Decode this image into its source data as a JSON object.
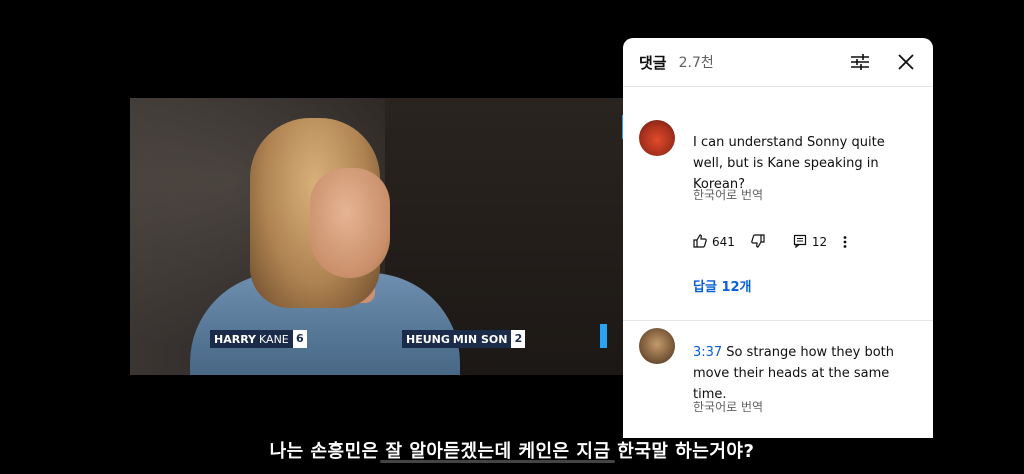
{
  "video": {
    "lower_thirds": [
      {
        "first": "HARRY",
        "last": "KANE",
        "number": "6"
      },
      {
        "first": "HEUNG",
        "last": "MIN SON",
        "number": "2"
      }
    ],
    "subtitle": "나는 손흥민은 잘 알아듣겠는데 케인은 지금 한국말 하는거야?"
  },
  "comments_panel": {
    "title": "댓글",
    "count": "2.7천",
    "icons": {
      "filter": "sliders-icon",
      "close": "close-icon"
    },
    "comments": [
      {
        "text": "I can understand Sonny quite well, but is Kane speaking in Korean?",
        "translate": "한국어로 번역",
        "likes": "641",
        "replies_count": "12",
        "replies_link": "답글 12개"
      },
      {
        "timestamp": "3:37",
        "text": "So strange how they both move their heads at the same time.",
        "translate": "한국어로 번역"
      }
    ]
  },
  "colors": {
    "accent": "#2aa3f0",
    "link": "#065fd4"
  }
}
